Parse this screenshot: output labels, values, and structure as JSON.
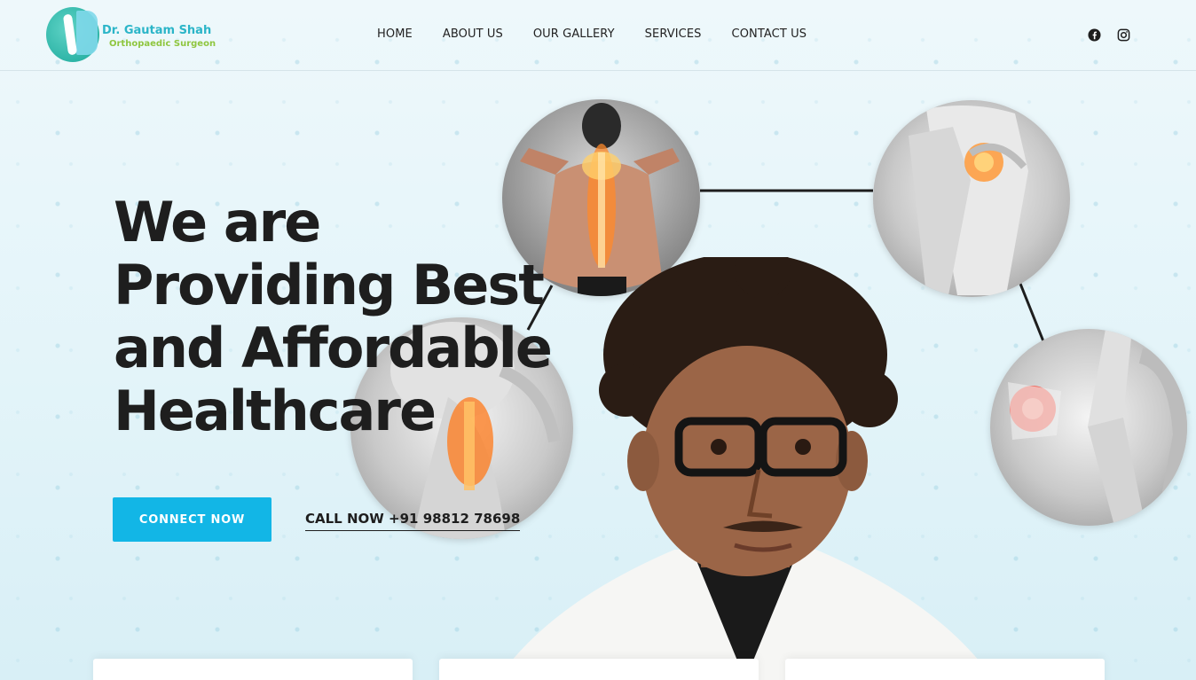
{
  "brand": {
    "name": "Dr. Gautam Shah",
    "tagline": "Orthopaedic Surgeon",
    "primary_color": "#2bb5c8",
    "secondary_color": "#8fc63f"
  },
  "nav": {
    "items": [
      {
        "label": "HOME"
      },
      {
        "label": "ABOUT US"
      },
      {
        "label": "OUR GALLERY"
      },
      {
        "label": "SERVICES"
      },
      {
        "label": "CONTACT US"
      }
    ]
  },
  "socials": {
    "icons": [
      "facebook-icon",
      "instagram-icon"
    ]
  },
  "hero": {
    "title_lines": [
      "We are",
      "Providing Best",
      "and Affordable",
      "Healthcare"
    ],
    "connect_button": "CONNECT NOW",
    "call_link": "CALL NOW +91 98812 78698",
    "accent_color": "#12b6e6"
  },
  "images": [
    {
      "name": "back-spine-pain"
    },
    {
      "name": "hip-joint-pain"
    },
    {
      "name": "neck-spine-pain"
    },
    {
      "name": "knee-joint-pain"
    },
    {
      "name": "doctor-portrait"
    }
  ]
}
